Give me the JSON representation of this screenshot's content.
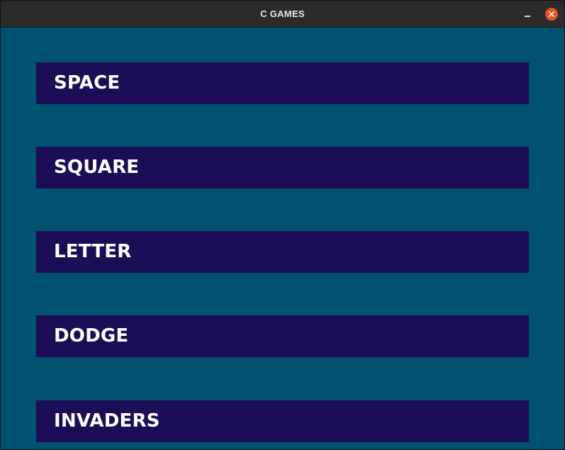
{
  "window": {
    "title": "C GAMES",
    "minimize_icon": "minimize-icon",
    "close_icon": "close-icon"
  },
  "menu": {
    "items": [
      {
        "label": "SPACE"
      },
      {
        "label": "SQUARE"
      },
      {
        "label": "LETTER"
      },
      {
        "label": "DODGE"
      },
      {
        "label": "INVADERS"
      }
    ]
  },
  "colors": {
    "background": "#005270",
    "button": "#1c0e56",
    "button_text": "#ffffff",
    "titlebar": "#2b2b2b",
    "close": "#e95420"
  }
}
